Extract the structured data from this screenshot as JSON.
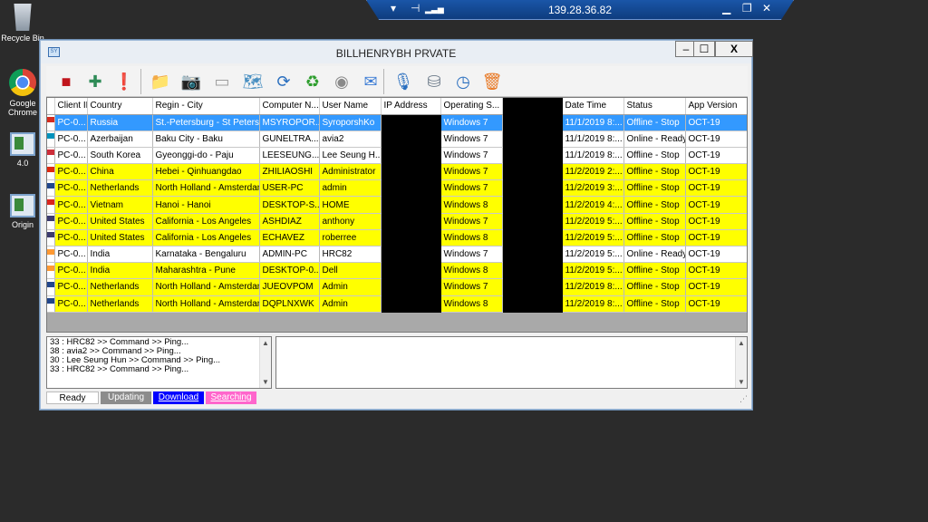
{
  "remote_bar": {
    "ip": "139.28.36.82"
  },
  "desktop": {
    "icons": [
      {
        "label": "Recycle Bin"
      },
      {
        "label": "Google Chrome"
      },
      {
        "label": "4.0"
      },
      {
        "label": "Origin"
      }
    ]
  },
  "window": {
    "title": "BILLHENRYBH PRVATE",
    "icon_text": "SY",
    "minimize": "–",
    "maximize": "☐",
    "close": "X"
  },
  "toolbar": {
    "buttons": [
      {
        "icon": "stop-icon",
        "glyph": "■",
        "color": "#c0151c"
      },
      {
        "icon": "puzzle-icon",
        "glyph": "✚",
        "color": "#2e8b57"
      },
      {
        "icon": "alert-icon",
        "glyph": "❗",
        "color": "#d32f2f"
      },
      {
        "icon": "folder-icon",
        "glyph": "📁",
        "color": "#e0a020"
      },
      {
        "icon": "webcam-icon",
        "glyph": "📷",
        "color": "#607d8b"
      },
      {
        "icon": "drive-icon",
        "glyph": "▭",
        "color": "#9e9e9e"
      },
      {
        "icon": "map-icon",
        "glyph": "🗺",
        "color": "#4a90c2"
      },
      {
        "icon": "refresh-icon",
        "glyph": "⟳",
        "color": "#2a6fbf"
      },
      {
        "icon": "recycle-icon",
        "glyph": "♻",
        "color": "#2e9e2e"
      },
      {
        "icon": "disc-icon",
        "glyph": "◉",
        "color": "#8a8a8a"
      },
      {
        "icon": "mail-icon",
        "glyph": "✉",
        "color": "#3a7bd5"
      },
      {
        "icon": "microphone-icon",
        "glyph": "🎙",
        "color": "#2a6fbf"
      },
      {
        "icon": "database-icon",
        "glyph": "⛁",
        "color": "#6d7b8a"
      },
      {
        "icon": "clock-icon",
        "glyph": "◷",
        "color": "#2a6fbf"
      },
      {
        "icon": "trash-icon",
        "glyph": "🗑",
        "color": "#e87722"
      }
    ]
  },
  "grid": {
    "columns": [
      {
        "key": "flag",
        "label": ""
      },
      {
        "key": "client_id",
        "label": "Client ID"
      },
      {
        "key": "country",
        "label": "Country"
      },
      {
        "key": "region",
        "label": "Regin - City"
      },
      {
        "key": "computer",
        "label": "Computer N..."
      },
      {
        "key": "user",
        "label": "User Name"
      },
      {
        "key": "ip",
        "label": "IP Address"
      },
      {
        "key": "os",
        "label": "Operating S..."
      },
      {
        "key": "hidden",
        "label": ""
      },
      {
        "key": "datetime",
        "label": "Date Time"
      },
      {
        "key": "status",
        "label": "Status"
      },
      {
        "key": "version",
        "label": "App Version"
      }
    ],
    "rows": [
      {
        "style": "sel",
        "flag_color": "#d52b1e",
        "client_id": "PC-0...",
        "country": "Russia",
        "region": "St.-Petersburg - St Petersb...",
        "computer": "MSYROPOR...",
        "user": "SyroporshKo",
        "os": "Windows 7",
        "datetime": "11/1/2019 8:...",
        "status": "Offline - Stop",
        "version": "OCT-19"
      },
      {
        "style": "white",
        "flag_color": "#0092bc",
        "client_id": "PC-0...",
        "country": "Azerbaijan",
        "region": "Baku City - Baku",
        "computer": "GUNELTRA...",
        "user": "avia2",
        "os": "Windows 7",
        "datetime": "11/1/2019 8:...",
        "status": "Online - Ready",
        "version": "OCT-19"
      },
      {
        "style": "white",
        "flag_color": "#cd2e3a",
        "client_id": "PC-0...",
        "country": "South Korea",
        "region": "Gyeonggi-do - Paju",
        "computer": "LEESEUNG...",
        "user": "Lee Seung H...",
        "os": "Windows 7",
        "datetime": "11/1/2019 8:...",
        "status": "Offline - Stop",
        "version": "OCT-19"
      },
      {
        "style": "yellow",
        "flag_color": "#de2910",
        "client_id": "PC-0...",
        "country": "China",
        "region": "Hebei - Qinhuangdao",
        "computer": "ZHILIAOSHI",
        "user": "Administrator",
        "os": "Windows 7",
        "datetime": "11/2/2019 2:...",
        "status": "Offline - Stop",
        "version": "OCT-19"
      },
      {
        "style": "yellow",
        "flag_color": "#21468b",
        "client_id": "PC-0...",
        "country": "Netherlands",
        "region": "North Holland - Amsterdam",
        "computer": "USER-PC",
        "user": "admin",
        "os": "Windows 7",
        "datetime": "11/2/2019 3:...",
        "status": "Offline - Stop",
        "version": "OCT-19"
      },
      {
        "style": "yellow",
        "flag_color": "#da251d",
        "client_id": "PC-0...",
        "country": "Vietnam",
        "region": "Hanoi - Hanoi",
        "computer": "DESKTOP-S...",
        "user": "HOME",
        "os": "Windows 8",
        "datetime": "11/2/2019 4:...",
        "status": "Offline - Stop",
        "version": "OCT-19"
      },
      {
        "style": "yellow",
        "flag_color": "#3c3b6e",
        "client_id": "PC-0...",
        "country": "United States",
        "region": "California - Los Angeles",
        "computer": "ASHDIAZ",
        "user": "anthony",
        "os": "Windows 7",
        "datetime": "11/2/2019 5:...",
        "status": "Offline - Stop",
        "version": "OCT-19"
      },
      {
        "style": "yellow",
        "flag_color": "#3c3b6e",
        "client_id": "PC-0...",
        "country": "United States",
        "region": "California - Los Angeles",
        "computer": "ECHAVEZ",
        "user": "roberree",
        "os": "Windows 8",
        "datetime": "11/2/2019 5:...",
        "status": "Offline - Stop",
        "version": "OCT-19"
      },
      {
        "style": "white",
        "flag_color": "#ff9933",
        "client_id": "PC-0...",
        "country": "India",
        "region": "Karnataka - Bengaluru",
        "computer": "ADMIN-PC",
        "user": "HRC82",
        "os": "Windows 7",
        "datetime": "11/2/2019 5:...",
        "status": "Online - Ready",
        "version": "OCT-19"
      },
      {
        "style": "yellow",
        "flag_color": "#ff9933",
        "client_id": "PC-0...",
        "country": "India",
        "region": "Maharashtra - Pune",
        "computer": "DESKTOP-0...",
        "user": "Dell",
        "os": "Windows 8",
        "datetime": "11/2/2019 5:...",
        "status": "Offline - Stop",
        "version": "OCT-19"
      },
      {
        "style": "yellow",
        "flag_color": "#21468b",
        "client_id": "PC-0...",
        "country": "Netherlands",
        "region": "North Holland - Amsterdam",
        "computer": "JUEOVPOM",
        "user": "Admin",
        "os": "Windows 7",
        "datetime": "11/2/2019 8:...",
        "status": "Offline - Stop",
        "version": "OCT-19"
      },
      {
        "style": "yellow",
        "flag_color": "#21468b",
        "client_id": "PC-0...",
        "country": "Netherlands",
        "region": "North Holland - Amsterdam",
        "computer": "DQPLNXWK",
        "user": "Admin",
        "os": "Windows 8",
        "datetime": "11/2/2019 8:...",
        "status": "Offline - Stop",
        "version": "OCT-19"
      }
    ]
  },
  "log": {
    "lines": [
      "33 : HRC82 >> Command >> Ping...",
      "38 : avia2 >> Command >> Ping...",
      "30 : Lee Seung Hun >> Command >> Ping...",
      "33 : HRC82 >> Command >> Ping..."
    ]
  },
  "statusbar": {
    "ready": "Ready",
    "updating": "Updating",
    "download": "Download",
    "searching": "Searching"
  },
  "colors": {
    "row_yellow": "#ffff00",
    "row_selected": "#3399ff",
    "download_bg": "#0000ff",
    "searching_bg": "#ff66cc",
    "updating_bg": "#8c8c8c"
  }
}
